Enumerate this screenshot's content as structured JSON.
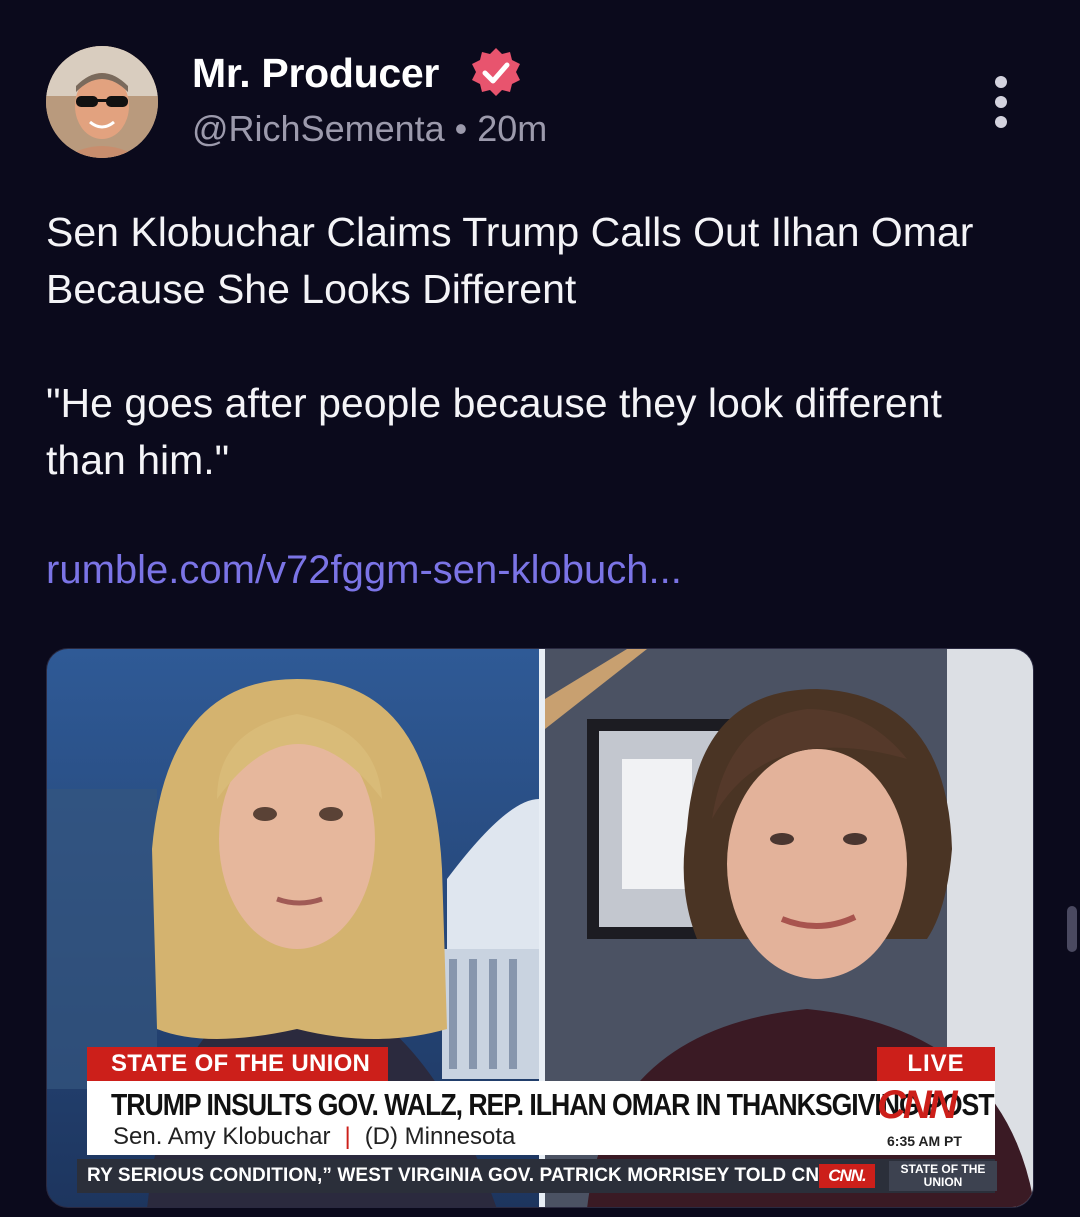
{
  "author": {
    "name": "Mr. Producer",
    "handle": "@RichSementa",
    "separator": "•",
    "time": "20m",
    "verified_icon": "verified-badge-icon",
    "verified_color": "#e8546e"
  },
  "post": {
    "title": "Sen Klobuchar Claims Trump Calls Out Ilhan Omar Because She Looks Different",
    "quote": "\"He goes after people because they look different than him.\"",
    "link_text": "rumble.com/v72fggm-sen-klobuch...",
    "link_color": "#7b74e6"
  },
  "media": {
    "show_tag": "STATE OF THE UNION",
    "live_tag": "LIVE",
    "headline": "TRUMP INSULTS GOV. WALZ, REP. ILHAN OMAR IN THANKSGIVING POST",
    "guest_name": "Sen. Amy Klobuchar",
    "guest_sep": "|",
    "guest_party": "(D) Minnesota",
    "network_logo": "CNN",
    "time": "6:35 AM PT",
    "ticker": "RY SERIOUS CONDITION,” WEST VIRGINIA GOV. PATRICK MORRISEY TOLD CNN.",
    "ticker_logo": "CNN.",
    "ticker_show": "STATE OF THE UNION",
    "accent": "#cc1f1a"
  },
  "colors": {
    "background": "#0b0a1c",
    "text": "#f4f4f7",
    "muted": "#9c9aac"
  }
}
